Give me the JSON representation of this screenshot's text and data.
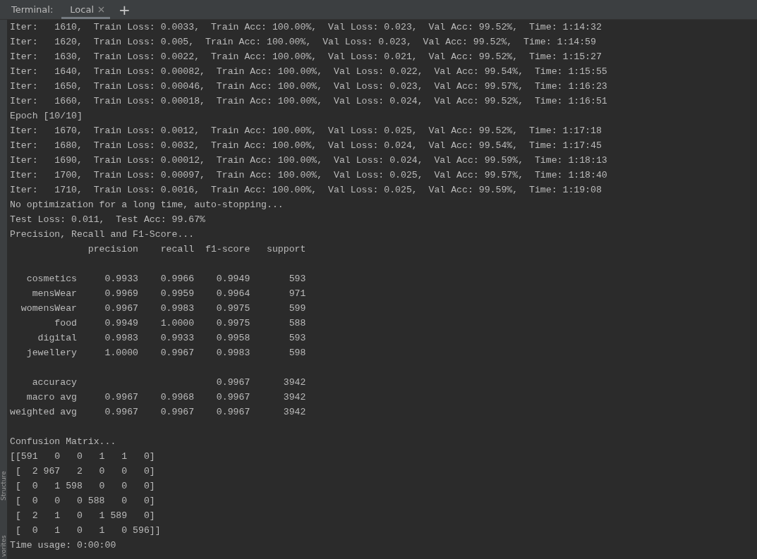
{
  "tool_window": {
    "title": "Terminal:",
    "tabs": [
      {
        "label": "Local",
        "selected": true,
        "closable": true
      }
    ],
    "new_tab": "+"
  },
  "side_strip": {
    "labels": [
      "Structure",
      "vorites"
    ]
  },
  "output": {
    "lines": [
      {
        "kind": "text",
        "text": "Iter:   1610,  Train Loss: 0.0033,  Train Acc: 100.00%,  Val Loss: 0.023,  Val Acc: 99.52%,  Time: 1:14:32"
      },
      {
        "kind": "text",
        "text": "Iter:   1620,  Train Loss: 0.005,  Train Acc: 100.00%,  Val Loss: 0.023,  Val Acc: 99.52%,  Time: 1:14:59"
      },
      {
        "kind": "text",
        "text": "Iter:   1630,  Train Loss: 0.0022,  Train Acc: 100.00%,  Val Loss: 0.021,  Val Acc: 99.52%,  Time: 1:15:27"
      },
      {
        "kind": "text",
        "text": "Iter:   1640,  Train Loss: 0.00082,  Train Acc: 100.00%,  Val Loss: 0.022,  Val Acc: 99.54%,  Time: 1:15:55"
      },
      {
        "kind": "text",
        "text": "Iter:   1650,  Train Loss: 0.00046,  Train Acc: 100.00%,  Val Loss: 0.023,  Val Acc: 99.57%,  Time: 1:16:23"
      },
      {
        "kind": "text",
        "text": "Iter:   1660,  Train Loss: 0.00018,  Train Acc: 100.00%,  Val Loss: 0.024,  Val Acc: 99.52%,  Time: 1:16:51"
      },
      {
        "kind": "text",
        "text": "Epoch [10/10]"
      },
      {
        "kind": "text",
        "text": "Iter:   1670,  Train Loss: 0.0012,  Train Acc: 100.00%,  Val Loss: 0.025,  Val Acc: 99.52%,  Time: 1:17:18"
      },
      {
        "kind": "text",
        "text": "Iter:   1680,  Train Loss: 0.0032,  Train Acc: 100.00%,  Val Loss: 0.024,  Val Acc: 99.54%,  Time: 1:17:45"
      },
      {
        "kind": "text",
        "text": "Iter:   1690,  Train Loss: 0.00012,  Train Acc: 100.00%,  Val Loss: 0.024,  Val Acc: 99.59%,  Time: 1:18:13"
      },
      {
        "kind": "text",
        "text": "Iter:   1700,  Train Loss: 0.00097,  Train Acc: 100.00%,  Val Loss: 0.025,  Val Acc: 99.57%,  Time: 1:18:40"
      },
      {
        "kind": "text",
        "text": "Iter:   1710,  Train Loss: 0.0016,  Train Acc: 100.00%,  Val Loss: 0.025,  Val Acc: 99.59%,  Time: 1:19:08"
      },
      {
        "kind": "text",
        "text": "No optimization for a long time, auto-stopping..."
      },
      {
        "kind": "text",
        "text": "Test Loss: 0.011,  Test Acc: 99.67%"
      },
      {
        "kind": "text",
        "text": "Precision, Recall and F1-Score..."
      },
      {
        "kind": "text",
        "text": "              precision    recall  f1-score   support"
      },
      {
        "kind": "blank"
      },
      {
        "kind": "text",
        "text": "   cosmetics     0.9933    0.9966    0.9949       593"
      },
      {
        "kind": "text",
        "text": "    mensWear     0.9969    0.9959    0.9964       971"
      },
      {
        "kind": "text",
        "text": "  womensWear     0.9967    0.9983    0.9975       599"
      },
      {
        "kind": "text",
        "text": "        food     0.9949    1.0000    0.9975       588"
      },
      {
        "kind": "text",
        "text": "     digital     0.9983    0.9933    0.9958       593"
      },
      {
        "kind": "text",
        "text": "   jewellery     1.0000    0.9967    0.9983       598"
      },
      {
        "kind": "blank"
      },
      {
        "kind": "text",
        "text": "    accuracy                         0.9967      3942"
      },
      {
        "kind": "text",
        "text": "   macro avg     0.9967    0.9968    0.9967      3942"
      },
      {
        "kind": "text",
        "text": "weighted avg     0.9967    0.9967    0.9967      3942"
      },
      {
        "kind": "blank"
      },
      {
        "kind": "text",
        "text": "Confusion Matrix..."
      },
      {
        "kind": "text",
        "text": "[[591   0   0   1   1   0]"
      },
      {
        "kind": "text",
        "text": " [  2 967   2   0   0   0]"
      },
      {
        "kind": "text",
        "text": " [  0   1 598   0   0   0]"
      },
      {
        "kind": "text",
        "text": " [  0   0   0 588   0   0]"
      },
      {
        "kind": "text",
        "text": " [  2   1   0   1 589   0]"
      },
      {
        "kind": "text",
        "text": " [  0   1   0   1   0 596]]"
      },
      {
        "kind": "text",
        "text": "Time usage: 0:00:00"
      }
    ]
  }
}
